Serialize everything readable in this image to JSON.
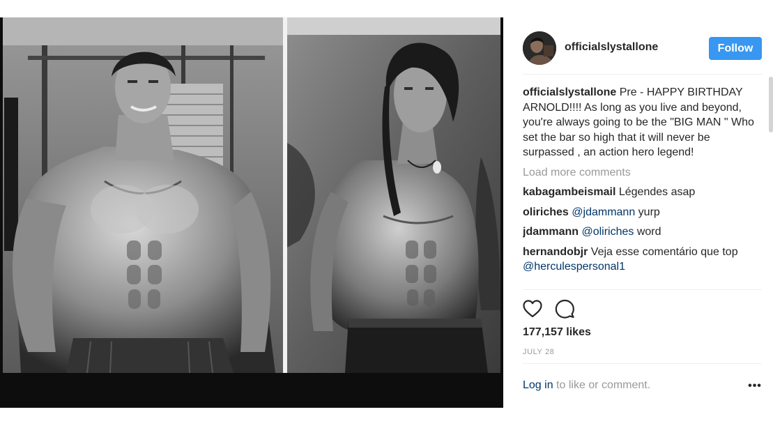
{
  "post": {
    "username": "officialslystallone",
    "follow_label": "Follow",
    "caption": {
      "user": "officialslystallone",
      "text": " Pre - HAPPY BIRTHDAY ARNOLD!!!! As long as you live and beyond, you're always going to be the \"BIG MAN \" Who set the bar so high that it will never be surpassed , an action hero legend!"
    },
    "load_more": "Load more comments",
    "comments": [
      {
        "user": "kabagambeismail",
        "pre": " Légendes asap",
        "mention": "",
        "post": ""
      },
      {
        "user": "oliriches",
        "pre": " ",
        "mention": "@jdammann",
        "post": " yurp"
      },
      {
        "user": "jdammann",
        "pre": " ",
        "mention": "@oliriches",
        "post": " word"
      },
      {
        "user": "hernandobjr",
        "pre": " Veja esse comentário que top ",
        "mention": "@herculespersonal1",
        "post": ""
      }
    ],
    "likes": "177,157 likes",
    "date": "JULY 28",
    "login_link": "Log in",
    "login_suffix": " to like or comment.",
    "more_label": "•••",
    "icons": {
      "like": "heart-icon",
      "comment": "comment-bubble-icon",
      "more": "more-options-icon"
    }
  },
  "colors": {
    "accent": "#3897f0",
    "link": "#003569",
    "muted": "#999999",
    "text": "#262626",
    "border": "#efefef"
  }
}
